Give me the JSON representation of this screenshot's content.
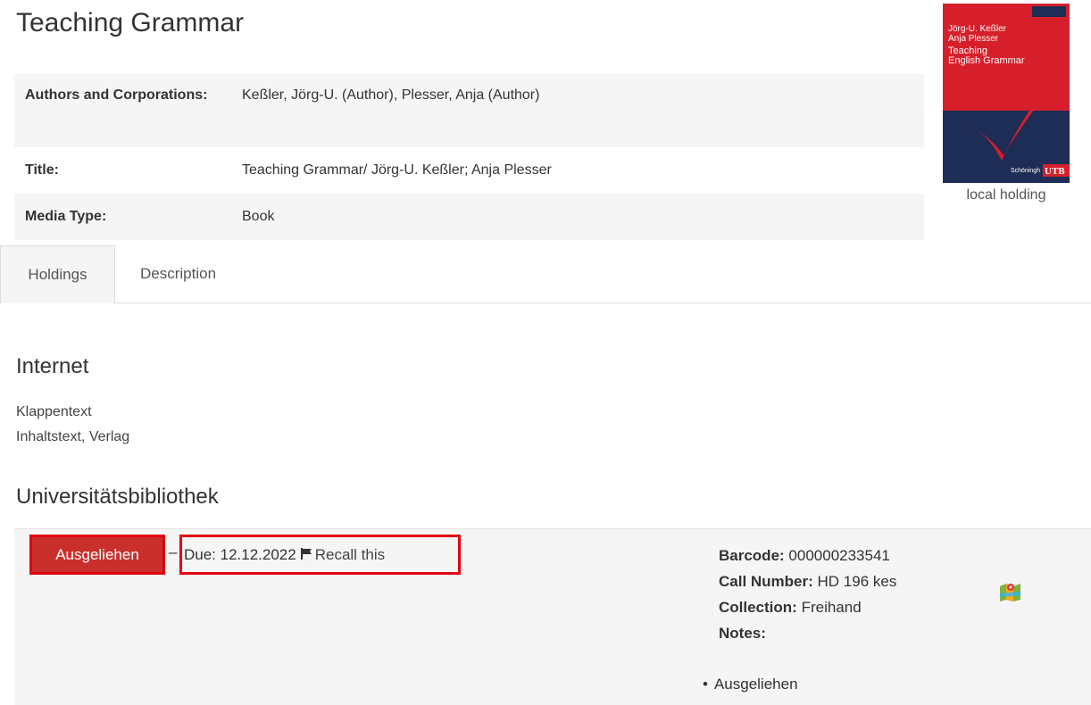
{
  "record": {
    "title": "Teaching Grammar",
    "fields": [
      {
        "label": "Authors and Corporations:",
        "value": "Keßler, Jörg-U. (Author), Plesser, Anja (Author)"
      },
      {
        "label": "Title:",
        "value": "Teaching Grammar/ Jörg-U. Keßler; Anja Plesser"
      },
      {
        "label": "Media Type:",
        "value": "Book"
      }
    ],
    "cover": {
      "authors_line1": "Jörg-U. Keßler",
      "authors_line2": "Anja Plesser",
      "title_line1": "Teaching",
      "title_line2": "English Grammar",
      "publisher": "Schöningh",
      "series": "UTB",
      "caption": "local holding"
    }
  },
  "tabs": [
    {
      "label": "Holdings",
      "active": true
    },
    {
      "label": "Description",
      "active": false
    }
  ],
  "internet": {
    "heading": "Internet",
    "links": [
      "Klappentext",
      "Inhaltstext, Verlag"
    ]
  },
  "library": {
    "heading": "Universitätsbibliothek",
    "status_label": "Ausgeliehen",
    "separator": "–",
    "due_text": "Due: 12.12.2022",
    "recall_text": "Recall this",
    "barcode_label": "Barcode:",
    "barcode": "000000233541",
    "call_number_label": "Call Number:",
    "call_number": "HD 196 kes",
    "collection_label": "Collection:",
    "collection": "Freihand",
    "notes_label": "Notes:",
    "notes": [
      "Ausgeliehen"
    ]
  },
  "colors": {
    "status_bg": "#c9302c",
    "highlight_border": "#e2000f",
    "cover_red": "#d71f2b",
    "cover_navy": "#1d2d55"
  }
}
